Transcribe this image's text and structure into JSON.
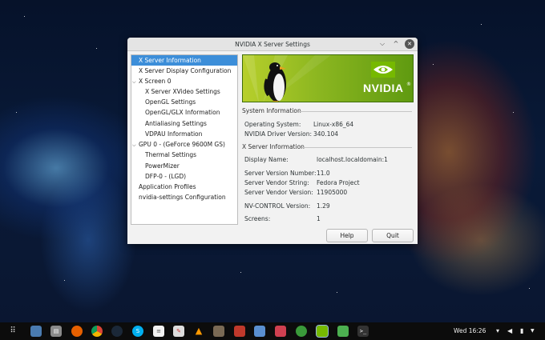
{
  "window": {
    "title": "NVIDIA X Server Settings",
    "controls": {
      "minimize": "⌵",
      "maximize": "^",
      "close": "✕"
    }
  },
  "tree": {
    "items": [
      {
        "label": "X Server Information",
        "selected": true
      },
      {
        "label": "X Server Display Configuration"
      },
      {
        "label": "X Screen 0",
        "expander": "⌵"
      },
      {
        "label": "X Server XVideo Settings"
      },
      {
        "label": "OpenGL Settings"
      },
      {
        "label": "OpenGL/GLX Information"
      },
      {
        "label": "Antialiasing Settings"
      },
      {
        "label": "VDPAU Information"
      },
      {
        "label": "GPU 0 - (GeForce 9600M GS)",
        "expander": "⌵"
      },
      {
        "label": "Thermal Settings"
      },
      {
        "label": "PowerMizer"
      },
      {
        "label": "DFP-0 - (LGD)"
      },
      {
        "label": "Application Profiles"
      },
      {
        "label": "nvidia-settings Configuration"
      }
    ]
  },
  "banner": {
    "brand": "NVIDIA",
    "trademark": "®"
  },
  "system_info": {
    "title": "System Information",
    "os_label": "Operating System:",
    "os_value": "Linux-x86_64",
    "driver_label": "NVIDIA Driver Version:",
    "driver_value": "340.104"
  },
  "xserver_info": {
    "title": "X Server Information",
    "display_label": "Display Name:",
    "display_value": "localhost.localdomain:1",
    "version_label": "Server Version Number:",
    "version_value": "11.0",
    "vendor_string_label": "Server Vendor String:",
    "vendor_string_value": "Fedora Project",
    "vendor_version_label": "Server Vendor Version:",
    "vendor_version_value": "11905000",
    "nvcontrol_label": "NV-CONTROL Version:",
    "nvcontrol_value": "1.29",
    "screens_label": "Screens:",
    "screens_value": "1"
  },
  "buttons": {
    "help": "Help",
    "quit": "Quit"
  },
  "taskbar": {
    "clock": "Wed 16:26",
    "apps": [
      "apps-grid-icon",
      "desktop-icon",
      "files-icon",
      "firefox-icon",
      "chrome-icon",
      "steam-icon",
      "skype-icon",
      "document-icon",
      "editor-icon",
      "vlc-icon",
      "gimp-icon",
      "slack-icon",
      "store-icon",
      "network-icon",
      "utility-icon",
      "nvidia-icon",
      "folder-icon",
      "terminal-icon"
    ]
  },
  "colors": {
    "selection": "#3c8ed9",
    "nvidia_green": "#76b900",
    "taskbar": "#0c0c0c"
  }
}
